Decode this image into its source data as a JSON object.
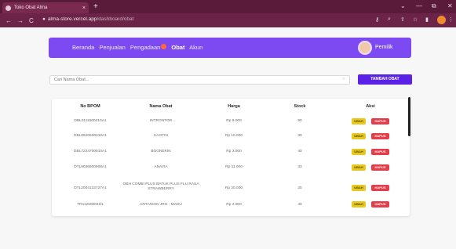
{
  "browser": {
    "tab_title": "Toko Obat Alma",
    "tab_close": "×",
    "new_tab": "+",
    "url_domain": "alma-store.vercel.app",
    "url_path": "/dashboard/obat",
    "window_min": "⌄",
    "window_minimize": "—",
    "window_restore": "⧉",
    "window_close": "✕",
    "back": "←",
    "forward": "→",
    "reload": "C",
    "lock": "🔒"
  },
  "navbar": {
    "links": [
      "Beranda",
      "Penjualan",
      "Pengadaan",
      "Obat",
      "Akun"
    ],
    "active": "Obat",
    "user_name": "Pemilik"
  },
  "search": {
    "placeholder": "Cari Nama Obat...",
    "add_button": "TAMBAH OBAT"
  },
  "table": {
    "headers": [
      "No BPOM",
      "Nama Obat",
      "Harga",
      "Stock",
      "Aksi"
    ],
    "edit_label": "UBAH",
    "delete_label": "HAPUS",
    "rows": [
      {
        "bpom": "DBL0111500210A1",
        "nama": "INTRONTOR",
        "harga": "Rp 9.000",
        "stock": "90"
      },
      {
        "bpom": "DBL0520500310A1",
        "nama": "KAOTIN",
        "harga": "Rp 10.000",
        "stock": "30"
      },
      {
        "bpom": "DBL7224700910A1",
        "nama": "BOONEKIN",
        "harga": "Rp 3.000",
        "stock": "40"
      },
      {
        "bpom": "DTL9036900908A1",
        "nama": "ANAVIA",
        "harga": "Rp 11.000",
        "stock": "33"
      },
      {
        "bpom": "DTL2004122727A1",
        "nama": "OBH COMBI PLUS BATUK PLUS FLU RASA STRAWBERRY",
        "harga": "Rp 20.000",
        "stock": "25"
      },
      {
        "bpom": "TR11250004H1",
        "nama": "ANTANGIN JRG - MADU",
        "harga": "Rp 4.000",
        "stock": "40"
      }
    ]
  }
}
